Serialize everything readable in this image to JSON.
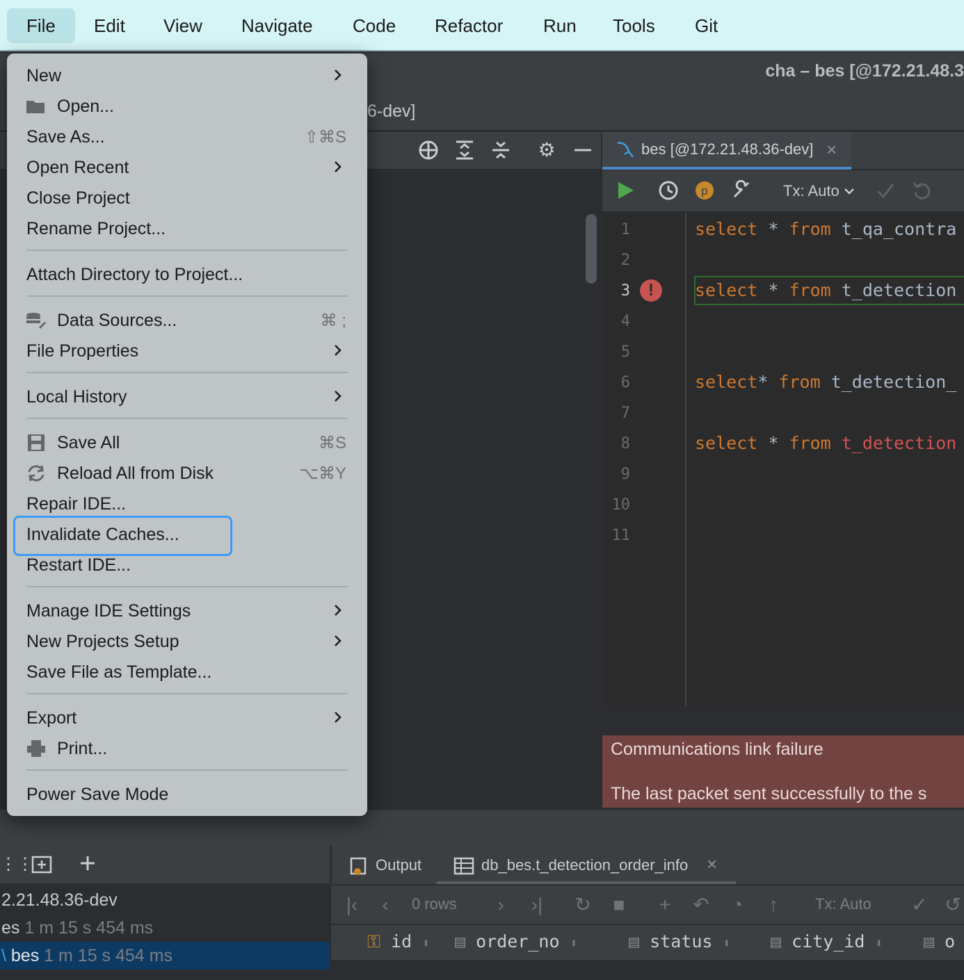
{
  "menubar": {
    "items": [
      "File",
      "Edit",
      "View",
      "Navigate",
      "Code",
      "Refactor",
      "Run",
      "Tools",
      "Git"
    ],
    "active": "File"
  },
  "window": {
    "title": "cha – bes [@172.21.48.3",
    "breadcrumb_tail": "6-dev]"
  },
  "editor": {
    "tab_label": "bes [@172.21.48.36-dev]",
    "tx_mode": "Tx: Auto",
    "line_numbers": [
      "1",
      "2",
      "3",
      "4",
      "5",
      "6",
      "7",
      "8",
      "9",
      "10",
      "11"
    ],
    "current_line": "3",
    "lines": [
      {
        "kw1": "select",
        "op": " * ",
        "kw2": "from",
        "rest": " t_qa_contra"
      },
      {
        "kw1": "select",
        "op": " * ",
        "kw2": "from",
        "rest": " t_detection"
      },
      {
        "kw1": "select",
        "op": "* ",
        "kw2": "from",
        "rest": " t_detection_"
      },
      {
        "kw1": "select",
        "op": " * ",
        "kw2": "from",
        "rest": " t_detection"
      }
    ]
  },
  "error_panel": {
    "line1": "Communications link failure",
    "line2": "The last packet sent successfully to the s"
  },
  "services": {
    "rows": [
      {
        "name": "2.21.48.36-dev",
        "time": ""
      },
      {
        "name": "es",
        "time": "1 m 15 s 454 ms"
      },
      {
        "name": "bes",
        "time": "1 m 15 s 454 ms"
      }
    ]
  },
  "results": {
    "tabs": [
      "Output",
      "db_bes.t_detection_order_info"
    ],
    "rows_label": "0 rows",
    "tx_mode": "Tx: Auto",
    "columns": [
      "id",
      "order_no",
      "status",
      "city_id",
      "o"
    ]
  },
  "file_menu": {
    "items": [
      {
        "label": "New",
        "shortcut": "",
        "submenu": true
      },
      {
        "label": "Open...",
        "shortcut": "",
        "submenu": false,
        "icon": "folder-icon"
      },
      {
        "label": "Save As...",
        "shortcut": "⇧⌘S",
        "submenu": false
      },
      {
        "label": "Open Recent",
        "shortcut": "",
        "submenu": true
      },
      {
        "label": "Close Project",
        "shortcut": "",
        "submenu": false
      },
      {
        "label": "Rename Project...",
        "shortcut": "",
        "submenu": false
      },
      {
        "label": "Attach Directory to Project...",
        "shortcut": "",
        "submenu": false
      },
      {
        "label": "Data Sources...",
        "shortcut": "⌘ ;",
        "submenu": false,
        "icon": "data-sources-icon"
      },
      {
        "label": "File Properties",
        "shortcut": "",
        "submenu": true
      },
      {
        "label": "Local History",
        "shortcut": "",
        "submenu": true
      },
      {
        "label": "Save All",
        "shortcut": "⌘S",
        "submenu": false,
        "icon": "save-icon"
      },
      {
        "label": "Reload All from Disk",
        "shortcut": "⌥⌘Y",
        "submenu": false,
        "icon": "reload-icon"
      },
      {
        "label": "Repair IDE...",
        "shortcut": "",
        "submenu": false
      },
      {
        "label": "Invalidate Caches...",
        "shortcut": "",
        "submenu": false
      },
      {
        "label": "Restart IDE...",
        "shortcut": "",
        "submenu": false
      },
      {
        "label": "Manage IDE Settings",
        "shortcut": "",
        "submenu": true
      },
      {
        "label": "New Projects Setup",
        "shortcut": "",
        "submenu": true
      },
      {
        "label": "Save File as Template...",
        "shortcut": "",
        "submenu": false
      },
      {
        "label": "Export",
        "shortcut": "",
        "submenu": true
      },
      {
        "label": "Print...",
        "shortcut": "",
        "submenu": false,
        "icon": "print-icon"
      },
      {
        "label": "Power Save Mode",
        "shortcut": "",
        "submenu": false
      }
    ],
    "highlighted": "Invalidate Caches..."
  },
  "colors": {
    "menubar_bg": "#d5f5f7",
    "menu_bg": "#bfc4c7",
    "highlight": "#3b9cf5",
    "keyword": "#cc7832",
    "error_bg": "#734341"
  }
}
